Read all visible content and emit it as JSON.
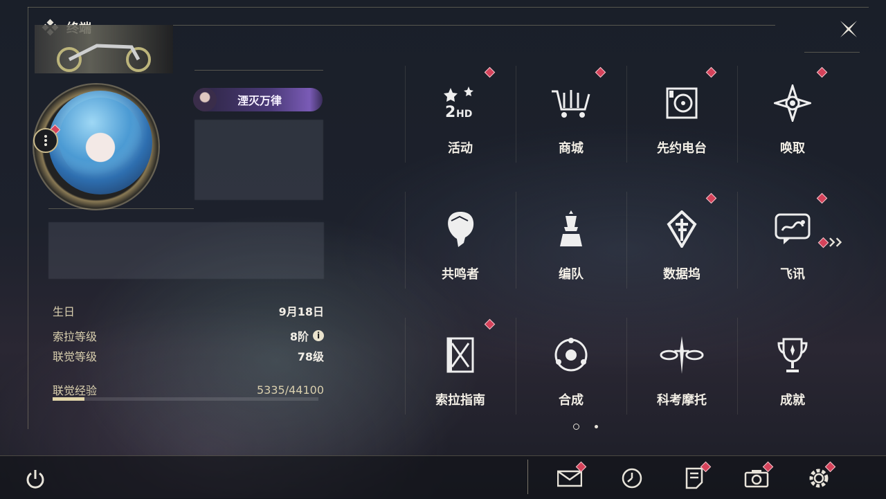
{
  "header": {
    "title": "终端"
  },
  "profile": {
    "tag_label": "湮灭万律",
    "info": [
      {
        "label": "生日",
        "value": "9月18日"
      },
      {
        "label": "索拉等级",
        "value": "8阶"
      },
      {
        "label": "联觉等级",
        "value": "78级"
      }
    ],
    "exp": {
      "label": "联觉经验",
      "value": "5335/44100",
      "current": 5335,
      "max": 44100
    }
  },
  "grid": [
    {
      "label": "活动",
      "icon": "event-icon",
      "badge": true
    },
    {
      "label": "商城",
      "icon": "shop-icon",
      "badge": true
    },
    {
      "label": "先约电台",
      "icon": "radio-icon",
      "badge": true
    },
    {
      "label": "唤取",
      "icon": "convene-icon",
      "badge": true
    },
    {
      "label": "共鸣者",
      "icon": "resonator-icon",
      "badge": false
    },
    {
      "label": "编队",
      "icon": "team-icon",
      "badge": false
    },
    {
      "label": "数据坞",
      "icon": "data-bank-icon",
      "badge": true
    },
    {
      "label": "飞讯",
      "icon": "message-icon",
      "badge": true
    },
    {
      "label": "索拉指南",
      "icon": "guide-icon",
      "badge": true
    },
    {
      "label": "合成",
      "icon": "synthesis-icon",
      "badge": false
    },
    {
      "label": "科考摩托",
      "icon": "motorcycle-icon",
      "badge": false
    },
    {
      "label": "成就",
      "icon": "achievement-icon",
      "badge": false
    }
  ],
  "pager": {
    "pages": 2,
    "current": 1
  },
  "bottom": [
    {
      "name": "mail-icon",
      "badge": true
    },
    {
      "name": "clock-icon",
      "badge": false
    },
    {
      "name": "notes-icon",
      "badge": true
    },
    {
      "name": "camera-icon",
      "badge": true
    },
    {
      "name": "settings-icon",
      "badge": true
    }
  ],
  "colors": {
    "accent": "#d5425a",
    "gold": "#d9cfae",
    "text": "#f3efe6"
  }
}
